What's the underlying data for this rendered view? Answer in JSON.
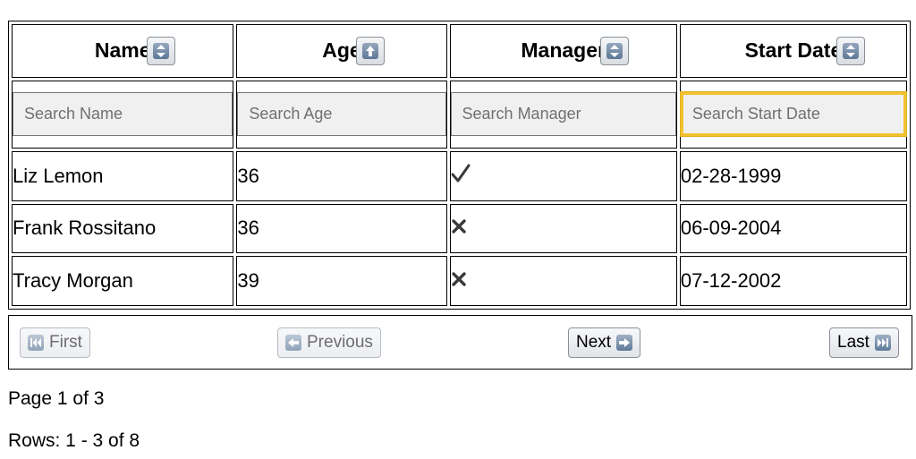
{
  "columns": [
    {
      "label": "Name",
      "sort_icon": "sort-both-icon",
      "placeholder": "Search Name"
    },
    {
      "label": "Age",
      "sort_icon": "sort-up-icon",
      "placeholder": "Search Age"
    },
    {
      "label": "Manager",
      "sort_icon": "sort-both-icon",
      "placeholder": "Search Manager"
    },
    {
      "label": "Start Date",
      "sort_icon": "sort-both-icon",
      "placeholder": "Search Start Date"
    }
  ],
  "rows": [
    {
      "name": "Liz Lemon",
      "age": "36",
      "manager": true,
      "manager_icon": "check-icon",
      "start_date": "02-28-1999"
    },
    {
      "name": "Frank Rossitano",
      "age": "36",
      "manager": false,
      "manager_icon": "x-icon",
      "start_date": "06-09-2004"
    },
    {
      "name": "Tracy Morgan",
      "age": "39",
      "manager": false,
      "manager_icon": "x-icon",
      "start_date": "07-12-2002"
    }
  ],
  "pager": {
    "first_label": "First",
    "previous_label": "Previous",
    "next_label": "Next",
    "last_label": "Last"
  },
  "status": {
    "page_text": "Page 1 of 3",
    "rows_text": "Rows: 1 - 3 of 8"
  },
  "colors": {
    "focus_border": "#f2c230",
    "icon_blue": "#5d7796"
  }
}
